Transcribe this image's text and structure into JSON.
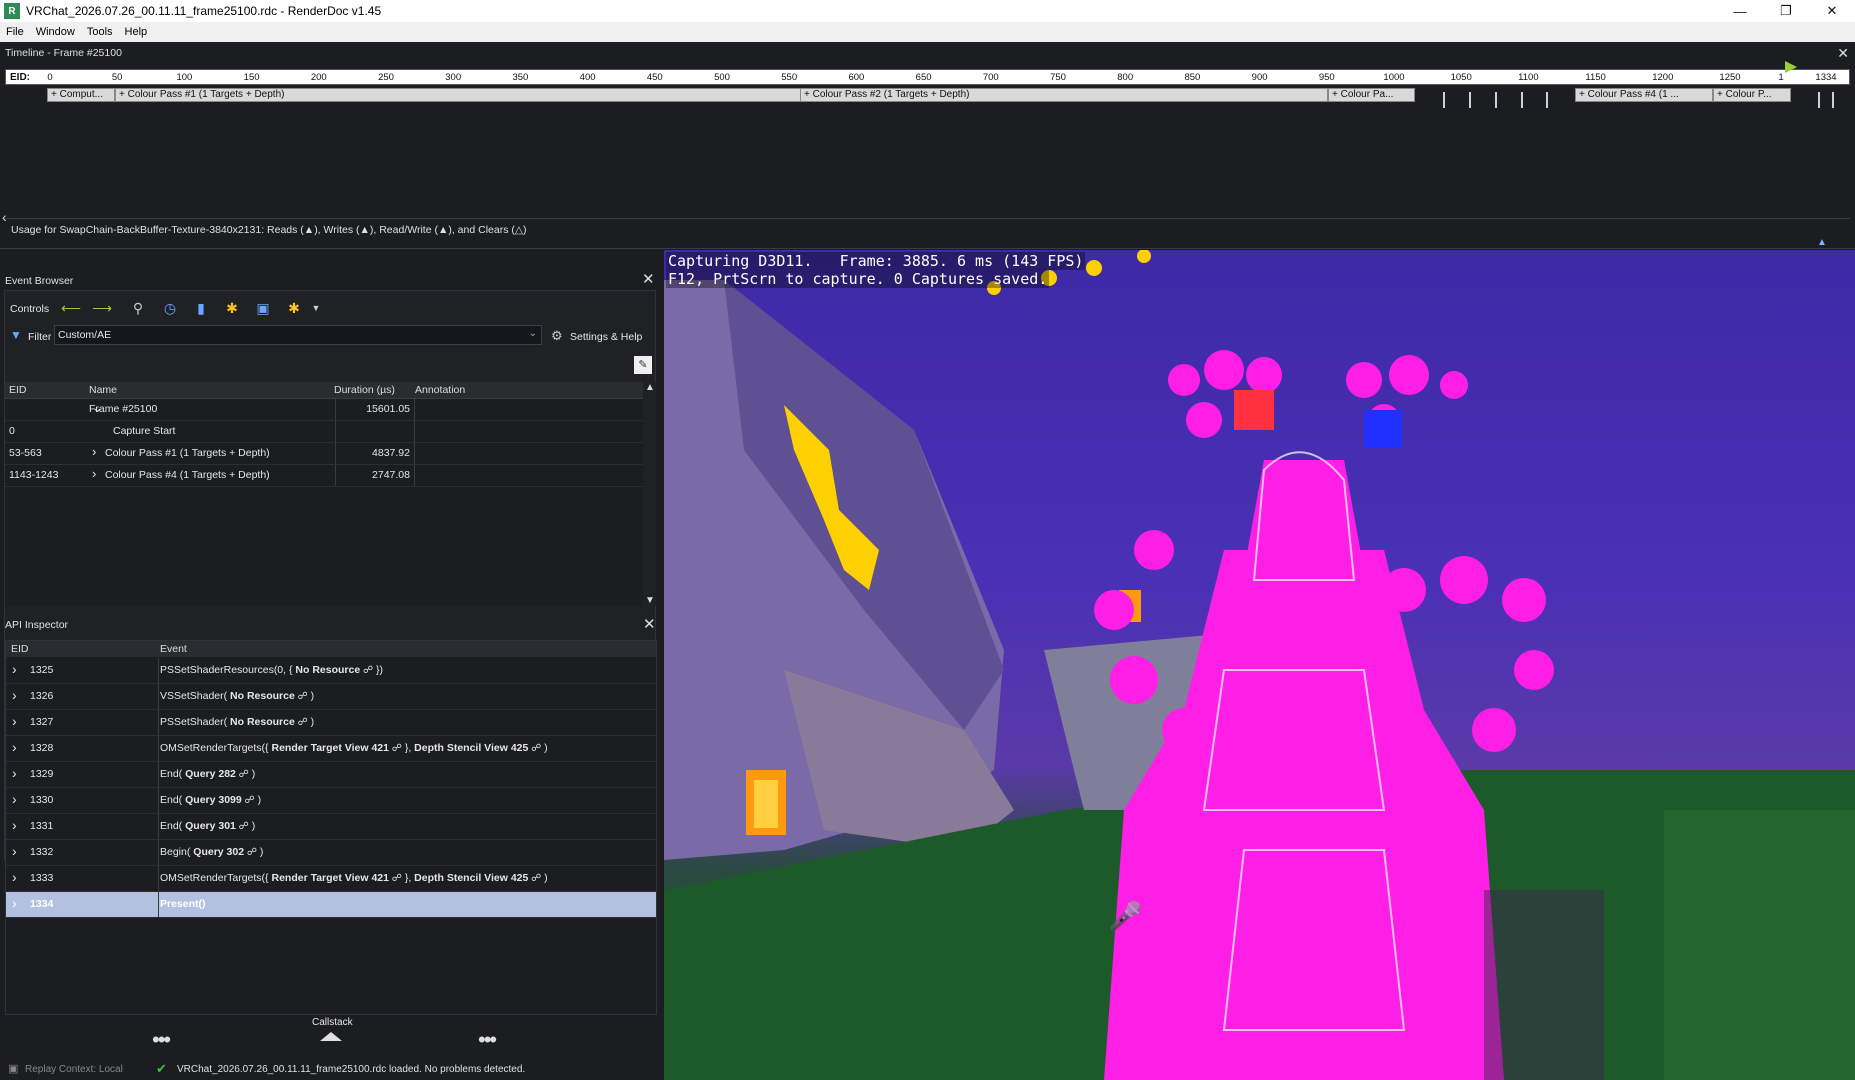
{
  "window": {
    "title": "VRChat_2026.07.26_00.11.11_frame25100.rdc - RenderDoc v1.45",
    "icon": "renderdoc-icon",
    "controls": [
      "minimize-icon",
      "restore-icon",
      "close-icon"
    ]
  },
  "menu": [
    "File",
    "Window",
    "Tools",
    "Help"
  ],
  "timeline": {
    "title": "Timeline - Frame #25100",
    "eid_label": "EID:",
    "ticks": [
      "0",
      "50",
      "100",
      "150",
      "200",
      "250",
      "300",
      "350",
      "400",
      "450",
      "500",
      "550",
      "600",
      "650",
      "700",
      "750",
      "800",
      "850",
      "900",
      "950",
      "1000",
      "1050",
      "1100",
      "1150",
      "1200",
      "1250",
      "1",
      "1334"
    ],
    "passes": [
      "+ Comput...",
      "+ Colour Pass #1 (1 Targets + Depth)",
      "+ Colour Pass #2 (1 Targets + Depth)",
      "+ Colour Pa...",
      "+ Colour Pass #4 (1 ...",
      "+ Colour P..."
    ],
    "usage": "Usage for SwapChain-BackBuffer-Texture-3840x2131: Reads (▲), Writes (▲), Read/Write (▲), and Clears (△)"
  },
  "event_browser": {
    "title": "Event Browser",
    "controls_label": "Controls",
    "filter_label": "Filter",
    "filter_value": "Custom/AE",
    "settings_label": "Settings & Help",
    "columns": [
      "EID",
      "Name",
      "Duration (µs)",
      "Annotation"
    ],
    "rows": [
      {
        "eid": "",
        "name": "Frame #25100",
        "duration": "15601.05",
        "annotation": ""
      },
      {
        "eid": "0",
        "name": "Capture Start",
        "duration": "",
        "annotation": ""
      },
      {
        "eid": "53-563",
        "name": "Colour Pass #1 (1 Targets + Depth)",
        "duration": "4837.92",
        "annotation": ""
      },
      {
        "eid": "1143-1243",
        "name": "Colour Pass #4 (1 Targets + Depth)",
        "duration": "2747.08",
        "annotation": ""
      }
    ]
  },
  "api_inspector": {
    "title": "API Inspector",
    "columns": [
      "EID",
      "Event"
    ],
    "rows": [
      {
        "eid": "1325",
        "pre": "PSSetShaderResources(0, {",
        "b1": "No Resource",
        "mid": "})",
        "b2": "",
        "post": ""
      },
      {
        "eid": "1326",
        "pre": "VSSetShader(",
        "b1": "No Resource",
        "mid": ")",
        "b2": "",
        "post": ""
      },
      {
        "eid": "1327",
        "pre": "PSSetShader(",
        "b1": "No Resource",
        "mid": ")",
        "b2": "",
        "post": ""
      },
      {
        "eid": "1328",
        "pre": "OMSetRenderTargets({",
        "b1": "Render Target View 421",
        "mid": "}, ",
        "b2": "Depth Stencil View 425",
        "post": ")"
      },
      {
        "eid": "1329",
        "pre": "End(",
        "b1": "Query 282",
        "mid": ")",
        "b2": "",
        "post": ""
      },
      {
        "eid": "1330",
        "pre": "End(",
        "b1": "Query 3099",
        "mid": ")",
        "b2": "",
        "post": ""
      },
      {
        "eid": "1331",
        "pre": "End(",
        "b1": "Query 301",
        "mid": ")",
        "b2": "",
        "post": ""
      },
      {
        "eid": "1332",
        "pre": "Begin(",
        "b1": "Query 302",
        "mid": ")",
        "b2": "",
        "post": ""
      },
      {
        "eid": "1333",
        "pre": "OMSetRenderTargets({",
        "b1": "Render Target View 421",
        "mid": "}, ",
        "b2": "Depth Stencil View 425",
        "post": ")"
      },
      {
        "eid": "1334",
        "pre": "Present()",
        "b1": "",
        "mid": "",
        "b2": "",
        "post": ""
      }
    ],
    "callstack_label": "Callstack"
  },
  "viewport": {
    "hud_line1": "Capturing D3D11.   Frame: 3885. 6 ms (143 FPS)",
    "hud_line2": "F12, PrtScrn to capture. 0 Captures saved."
  },
  "status": {
    "replay_context": "Replay Context: Local",
    "message": "VRChat_2026.07.26_00.11.11_frame25100.rdc loaded. No problems detected."
  },
  "colors": {
    "accent_selected_row": "#b4c0e0",
    "flag": "#9acd32",
    "toolbar_arrow": "#9acd32"
  }
}
